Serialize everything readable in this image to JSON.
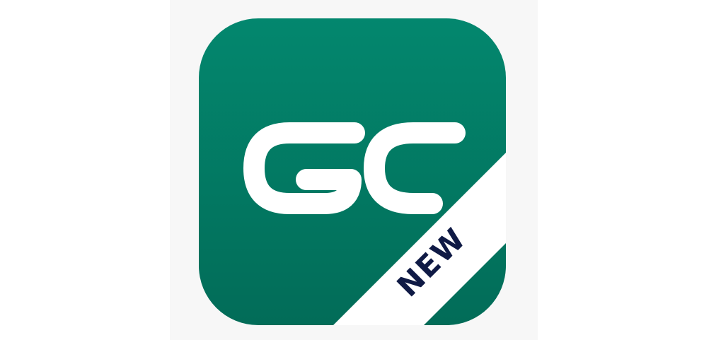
{
  "icon": {
    "monogram": "GC",
    "ribbon_label": "NEW",
    "colors": {
      "brand_top": "#03876e",
      "brand_bottom": "#026c58",
      "monogram": "#ffffff",
      "ribbon": "#ffffff",
      "ribbon_text": "#0f1a45",
      "backdrop": "#f7f7f7"
    }
  }
}
